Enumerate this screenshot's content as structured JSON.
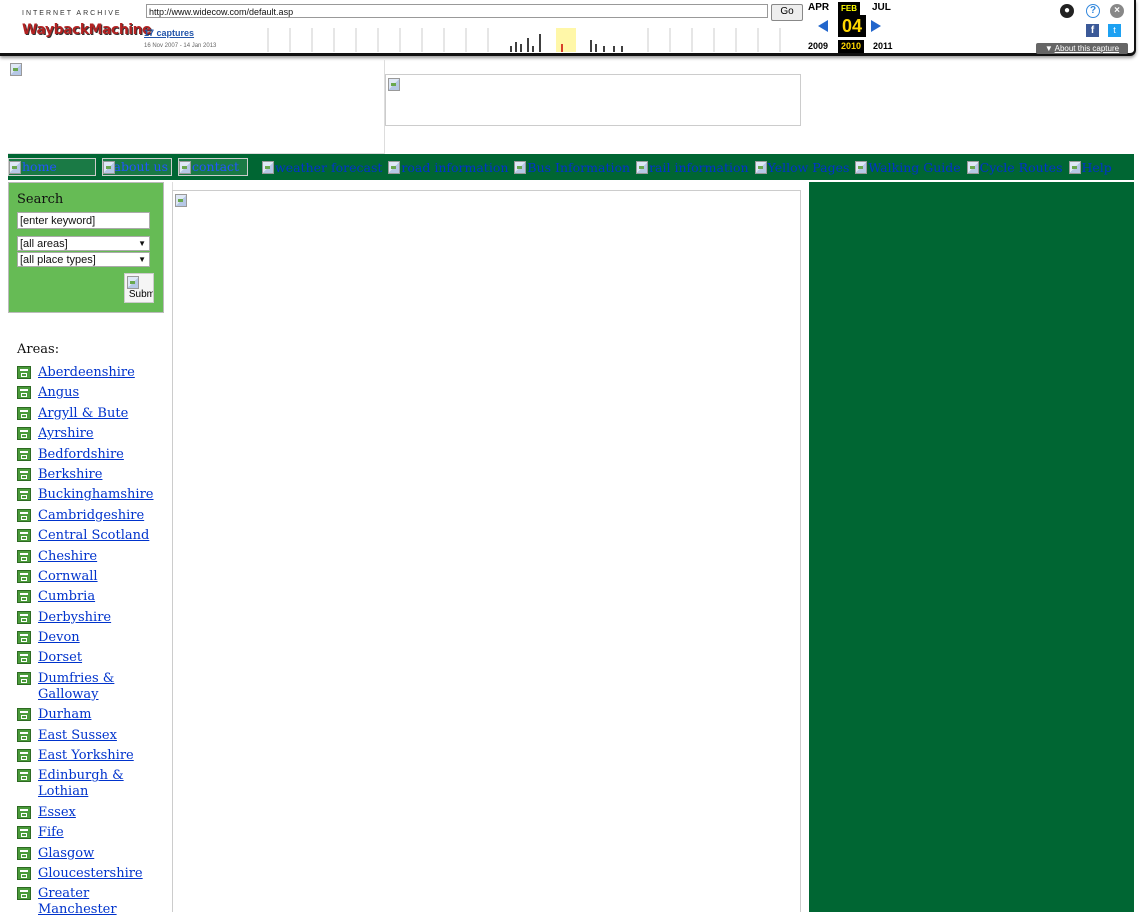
{
  "wayback": {
    "brand_small": "INTERNET ARCHIVE",
    "brand_logo": "WaybackMachine",
    "url": "http://www.widecow.com/default.asp",
    "go_label": "Go",
    "captures_label": "17 captures",
    "capture_range": "16 Nov 2007 - 14 Jan 2013",
    "month_prev": "APR",
    "month_cur": "FEB",
    "month_next": "JUL",
    "day": "04",
    "year_prev": "2009",
    "year_cur": "2010",
    "year_next": "2011",
    "about_label": "About this capture"
  },
  "nav": {
    "items": [
      {
        "label": "home",
        "boxed": true
      },
      {
        "label": "about us",
        "boxed": true
      },
      {
        "label": "contact",
        "boxed": true
      },
      {
        "label": "weather forecast",
        "boxed": false
      },
      {
        "label": "road information",
        "boxed": false
      },
      {
        "label": "Bus Information",
        "boxed": false
      },
      {
        "label": "rail information",
        "boxed": false
      },
      {
        "label": "Yellow Pages",
        "boxed": false
      },
      {
        "label": "Walking Guide",
        "boxed": false
      },
      {
        "label": "Cycle Routes",
        "boxed": false
      },
      {
        "label": "Help",
        "boxed": false
      }
    ]
  },
  "search": {
    "title": "Search",
    "keyword_value": "[enter keyword]",
    "area_select": "[all areas]",
    "place_select": "[all place types]",
    "submit_label": "Subm"
  },
  "areas": {
    "heading": "Areas:",
    "items": [
      "Aberdeenshire",
      "Angus",
      "Argyll & Bute",
      "Ayrshire",
      "Bedfordshire",
      "Berkshire",
      "Buckinghamshire",
      "Cambridgeshire",
      "Central Scotland",
      "Cheshire",
      "Cornwall",
      "Cumbria",
      "Derbyshire",
      "Devon",
      "Dorset",
      "Dumfries & Galloway",
      "Durham",
      "East Sussex",
      "East Yorkshire",
      "Edinburgh & Lothian",
      "Essex",
      "Fife",
      "Glasgow",
      "Gloucestershire",
      "Greater Manchester"
    ]
  },
  "colors": {
    "nav_green": "#006633",
    "search_green": "#66bb55",
    "link_blue": "#0033cc"
  }
}
